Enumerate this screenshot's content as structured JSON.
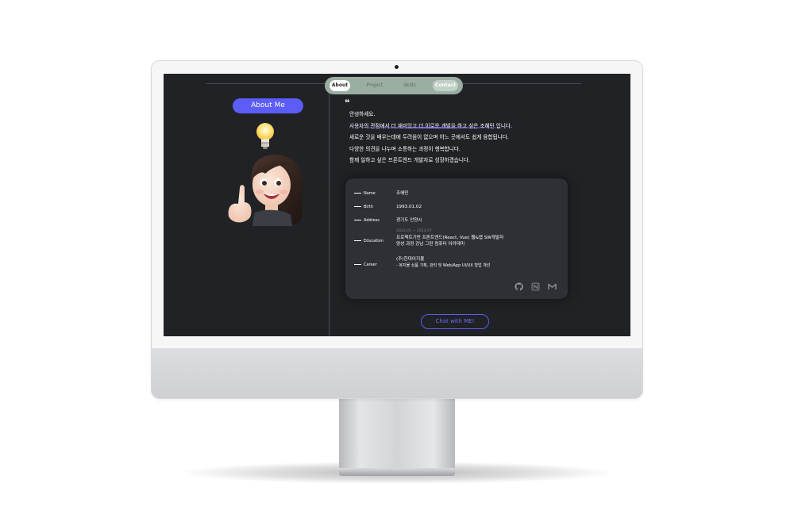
{
  "nav": {
    "items": [
      {
        "label": "About"
      },
      {
        "label": "Project"
      },
      {
        "label": "Skills"
      },
      {
        "label": "Contact"
      }
    ]
  },
  "left": {
    "button_label": "About Me"
  },
  "intro": {
    "lines": [
      "안녕하세요.",
      "사용자의 관점에서 더 재미있고 더 이로운 개발을 하고 싶은 조혜민 입니다.",
      "새로운 것을 배우는데에 두려움이 없으며 어느 곳에서도 쉽게 융합됩니다.",
      "다양한 의견을 나누며 소통하는 과정이 행복합니다.",
      "함께 일하고 싶은 프론트엔드 개발자로 성장하겠습니다."
    ]
  },
  "profile": {
    "name_label": "Name",
    "name_value": "조혜민",
    "birth_label": "Birth",
    "birth_value": "1993.01.02",
    "address_label": "Address",
    "address_value": "경기도 안양시",
    "education_label": "Education",
    "education_period": "2023.01 ~ 2023.07",
    "education_line1": "프로젝트기반 프론트엔드(React, Vue) 웹&앱 SW개발자",
    "education_line2": "양성 과정 강남 그린 컴퓨터 아카데미",
    "career_label": "Career",
    "career_line1": "(주)한대이지몰",
    "career_line2": "- 복지몰 상품 기획, 관리 및 Web/App UI/UX 형업 개선"
  },
  "social_icons": [
    "github-icon",
    "notion-icon",
    "gmail-icon"
  ],
  "chat_button_label": "Chat with ME!",
  "colors": {
    "accent": "#5b5df6",
    "screen_bg": "#202225",
    "card_bg": "#2d3034",
    "nav_bg": "#9aaea2"
  }
}
